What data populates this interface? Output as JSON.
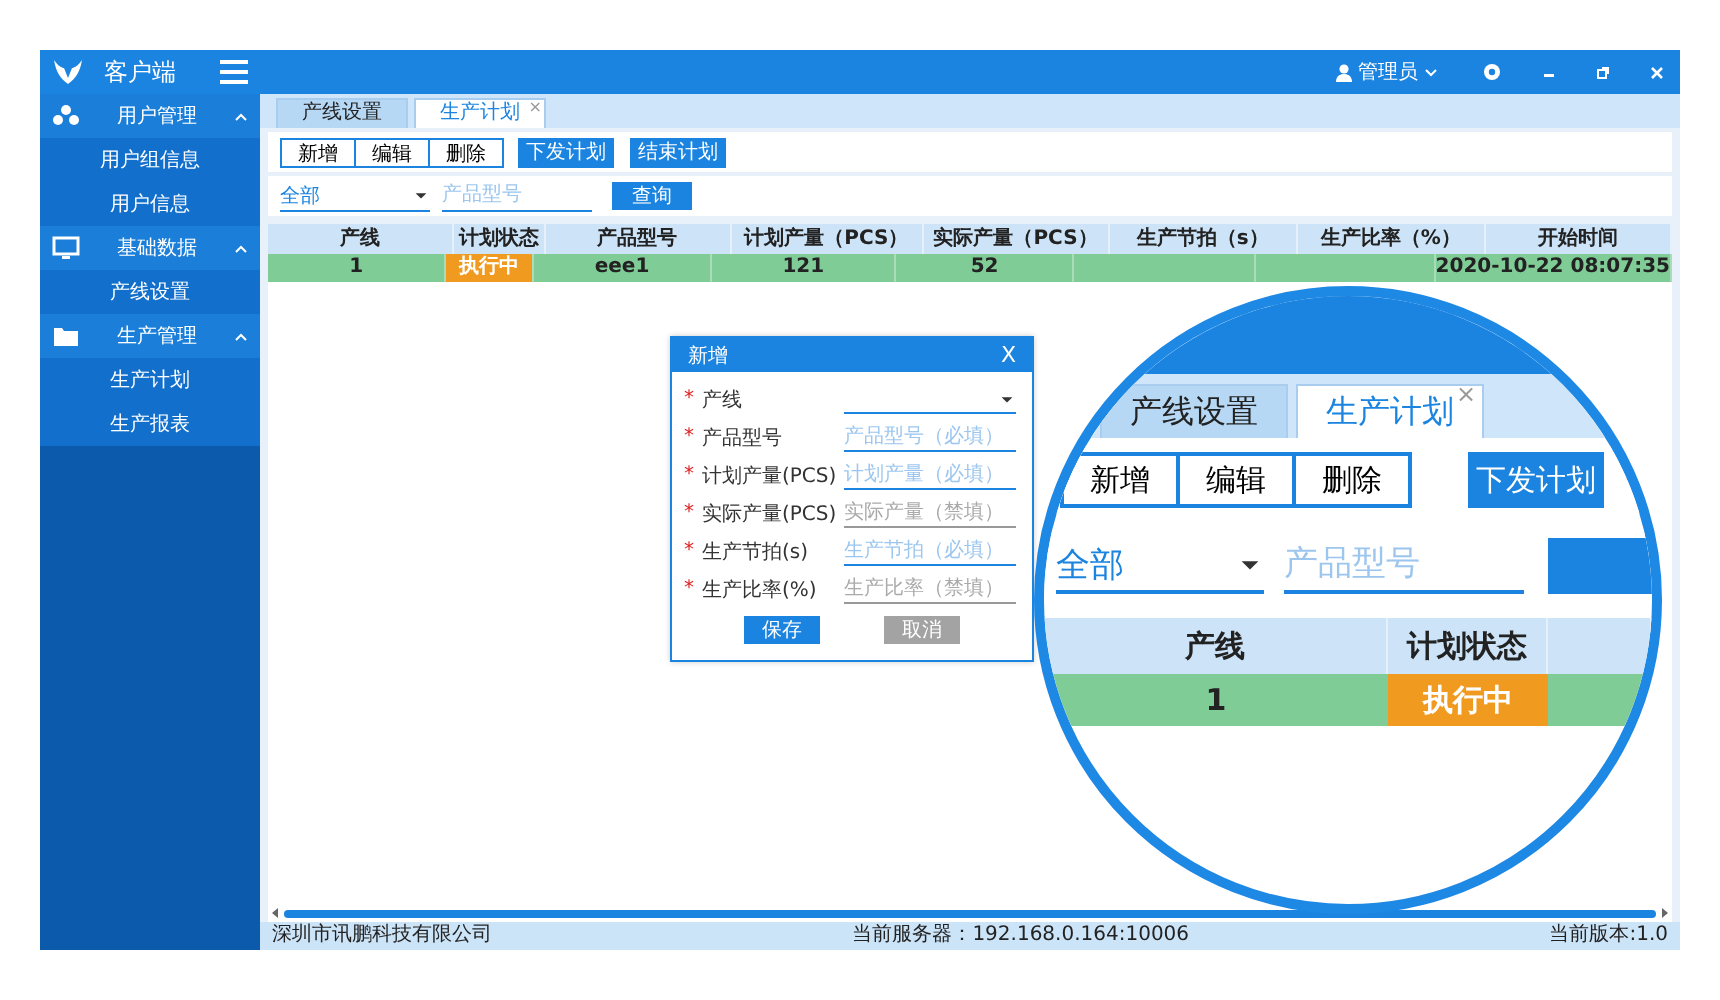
{
  "app": {
    "title": "客户端",
    "user": "管理员"
  },
  "sidebar": {
    "groups": [
      {
        "label": "用户管理",
        "expanded": true,
        "items": [
          {
            "label": "用户组信息",
            "selected": false
          },
          {
            "label": "用户信息",
            "selected": false
          }
        ]
      },
      {
        "label": "基础数据",
        "expanded": true,
        "items": [
          {
            "label": "产线设置",
            "selected": false
          }
        ]
      },
      {
        "label": "生产管理",
        "expanded": true,
        "items": [
          {
            "label": "生产计划",
            "selected": false
          },
          {
            "label": "生产报表",
            "selected": false
          }
        ]
      }
    ]
  },
  "tabs": [
    {
      "label": "产线设置",
      "selected": false
    },
    {
      "label": "生产计划",
      "selected": true,
      "close": "×"
    }
  ],
  "toolbar": {
    "group_buttons": [
      "新增",
      "编辑",
      "删除"
    ],
    "action_buttons": [
      "下发计划",
      "结束计划"
    ]
  },
  "filter": {
    "line_select": "全部",
    "model_input": {
      "placeholder": "产品型号"
    },
    "query_button": "查询"
  },
  "table": {
    "columns": [
      "产线",
      "计划状态",
      "产品型号",
      "计划产量（PCS）",
      "实际产量（PCS）",
      "生产节拍（s）",
      "生产比率（%）",
      "开始时间"
    ],
    "rows": [
      {
        "cells": [
          {
            "text": "1"
          },
          {
            "text": "执行中",
            "kind": "status"
          },
          {
            "text": "eee1"
          },
          {
            "text": "121"
          },
          {
            "text": "52"
          },
          {
            "kind": "covered"
          },
          {
            "kind": "covered"
          },
          {
            "text": "2020-10-22 08:07:35"
          }
        ]
      }
    ]
  },
  "dialog": {
    "title": "新增",
    "close": "X",
    "fields": [
      {
        "required_mark": "*",
        "label": "产线",
        "kind": "select",
        "disabled": false
      },
      {
        "required_mark": "*",
        "label": "产品型号",
        "kind": "input",
        "placeholder": "产品型号（必填）",
        "disabled": false
      },
      {
        "required_mark": "*",
        "label": "计划产量(PCS)",
        "kind": "input",
        "placeholder": "计划产量（必填）",
        "disabled": false
      },
      {
        "required_mark": "*",
        "label": "实际产量(PCS)",
        "kind": "input",
        "placeholder": "实际产量（禁填）",
        "disabled": true
      },
      {
        "required_mark": "*",
        "label": "生产节拍(s)",
        "kind": "input",
        "placeholder": "生产节拍（必填）",
        "disabled": false
      },
      {
        "required_mark": "*",
        "label": "生产比率(%)",
        "kind": "input",
        "placeholder": "生产比率（禁填）",
        "disabled": true
      }
    ],
    "buttons": [
      {
        "label": "保存",
        "kind": "primary"
      },
      {
        "label": "取消",
        "kind": "secondary"
      }
    ]
  },
  "status_bar": {
    "company": "深圳市讯鹏科技有限公司",
    "server": "当前服务器：192.168.0.164:10006",
    "version": "当前版本:1.0"
  },
  "magnifier": {
    "tabs": [
      {
        "label": "产线设置",
        "selected": false
      },
      {
        "label": "生产计划",
        "selected": true,
        "close": "×"
      }
    ],
    "group_buttons": [
      "新增",
      "编辑",
      "删除"
    ],
    "action_buttons": [
      "下发计划"
    ],
    "filter": {
      "line_select": "全部",
      "model_input": {
        "placeholder": "产品型号"
      }
    },
    "columns": [
      "产线",
      "计划状态"
    ],
    "row": [
      {
        "text": "1"
      },
      {
        "text": "执行中",
        "kind": "status"
      }
    ]
  }
}
